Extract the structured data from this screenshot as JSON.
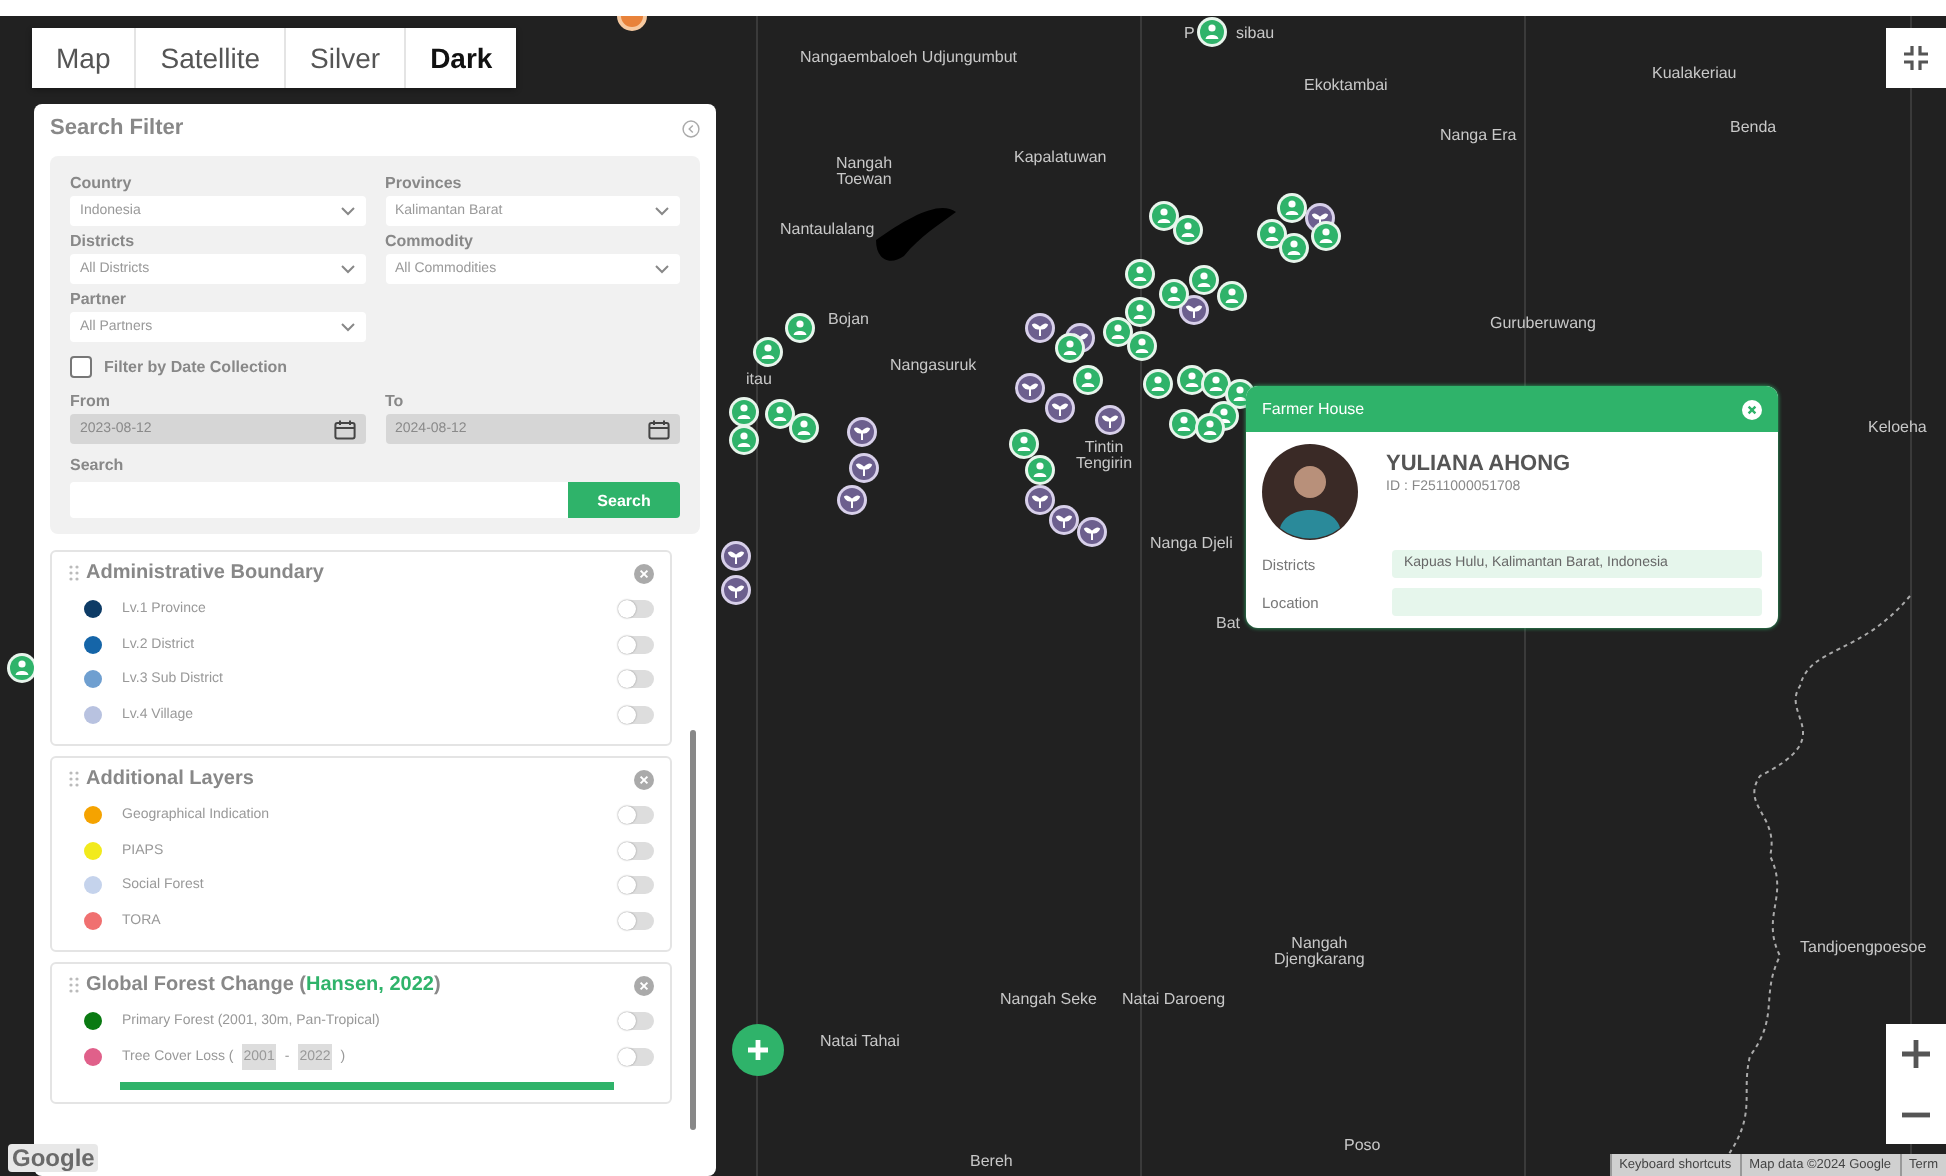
{
  "map_types": [
    {
      "label": "Map",
      "selected": false
    },
    {
      "label": "Satellite",
      "selected": false
    },
    {
      "label": "Silver",
      "selected": false
    },
    {
      "label": "Dark",
      "selected": true
    }
  ],
  "map_labels": [
    "Nangaembaloeh Udjungumbut",
    "P",
    "sibau",
    "Ekoktambai",
    "Kualakeriau",
    "Nanga Era",
    "Benda",
    "Nangah\nToewan",
    "Kapalatuwan",
    "Nantaulalang",
    "Bojan",
    "itau",
    "Nangasuruk",
    "Guruberuwang",
    "Keloeha",
    "Tintin\nTengirin",
    "Nanga Djeli",
    "Bat",
    "Nangah\nDjengkarang",
    "Nangah Seke",
    "Natai Daroeng",
    "Natai Tahai",
    "Tandjoengpoesoe",
    "Poso",
    "Bereh"
  ],
  "filter_panel": {
    "title": "Search Filter",
    "fields": [
      {
        "label": "Country",
        "value": "Indonesia"
      },
      {
        "label": "Provinces",
        "value": "Kalimantan Barat"
      },
      {
        "label": "Districts",
        "value": "All Districts"
      },
      {
        "label": "Commodity",
        "value": "All Commodities"
      },
      {
        "label": "Partner",
        "value": "All Partners"
      }
    ],
    "date_filter": {
      "label": "Filter by Date Collection",
      "checked": false
    },
    "dates": [
      {
        "label": "From",
        "value": "2023-08-12",
        "disabled": true
      },
      {
        "label": "To",
        "value": "2024-08-12",
        "disabled": true
      }
    ],
    "search": {
      "label": "Search",
      "button": "Search"
    }
  },
  "layer_groups": [
    {
      "title": "Administrative Boundary",
      "items": [
        {
          "kind": "toggle",
          "label": "Lv.1 Province",
          "color": "#0d3b66",
          "on": false
        },
        {
          "kind": "toggle",
          "label": "Lv.2 District",
          "color": "#1565a8",
          "on": false
        },
        {
          "kind": "toggle",
          "label": "Lv.3 Sub District",
          "color": "#6f9fd0",
          "on": false
        },
        {
          "kind": "toggle",
          "label": "Lv.4 Village",
          "color": "#b8c2e0",
          "on": false
        }
      ]
    },
    {
      "title": "Additional Layers",
      "items": [
        {
          "kind": "toggle",
          "label": "Geographical Indication",
          "color": "#f5a300",
          "on": false
        },
        {
          "kind": "toggle",
          "label": "PIAPS",
          "color": "#f2ea1c",
          "on": false
        },
        {
          "kind": "toggle",
          "label": "Social Forest",
          "color": "#c5d3ec",
          "on": false
        },
        {
          "kind": "toggle",
          "label": "TORA",
          "color": "#f07070",
          "on": false
        }
      ]
    },
    {
      "title": "Global Forest Change (",
      "source": "Hansen, 2022",
      "title_end": ")",
      "items": [
        {
          "kind": "toggle",
          "label": "Primary Forest (2001, 30m, Pan-Tropical)",
          "color": "#0a7a12",
          "on": false
        },
        {
          "kind": "range",
          "label": "Tree Cover Loss (",
          "from": "2001",
          "separator": "-",
          "to": "2022",
          "suffix": ")",
          "color": "#e0608a",
          "on": false,
          "level": 1
        }
      ]
    }
  ],
  "popup": {
    "title": "Farmer House",
    "name": "YULIANA AHONG",
    "id": "ID : F2511000051708",
    "rows": [
      {
        "label": "Districts",
        "value": "Kapuas Hulu, Kalimantan Barat, Indonesia"
      },
      {
        "label": "Location",
        "value": ""
      }
    ]
  },
  "logo": "Google",
  "attribution": [
    "Keyboard shortcuts",
    "Map data ©2024 Google",
    "Term"
  ]
}
